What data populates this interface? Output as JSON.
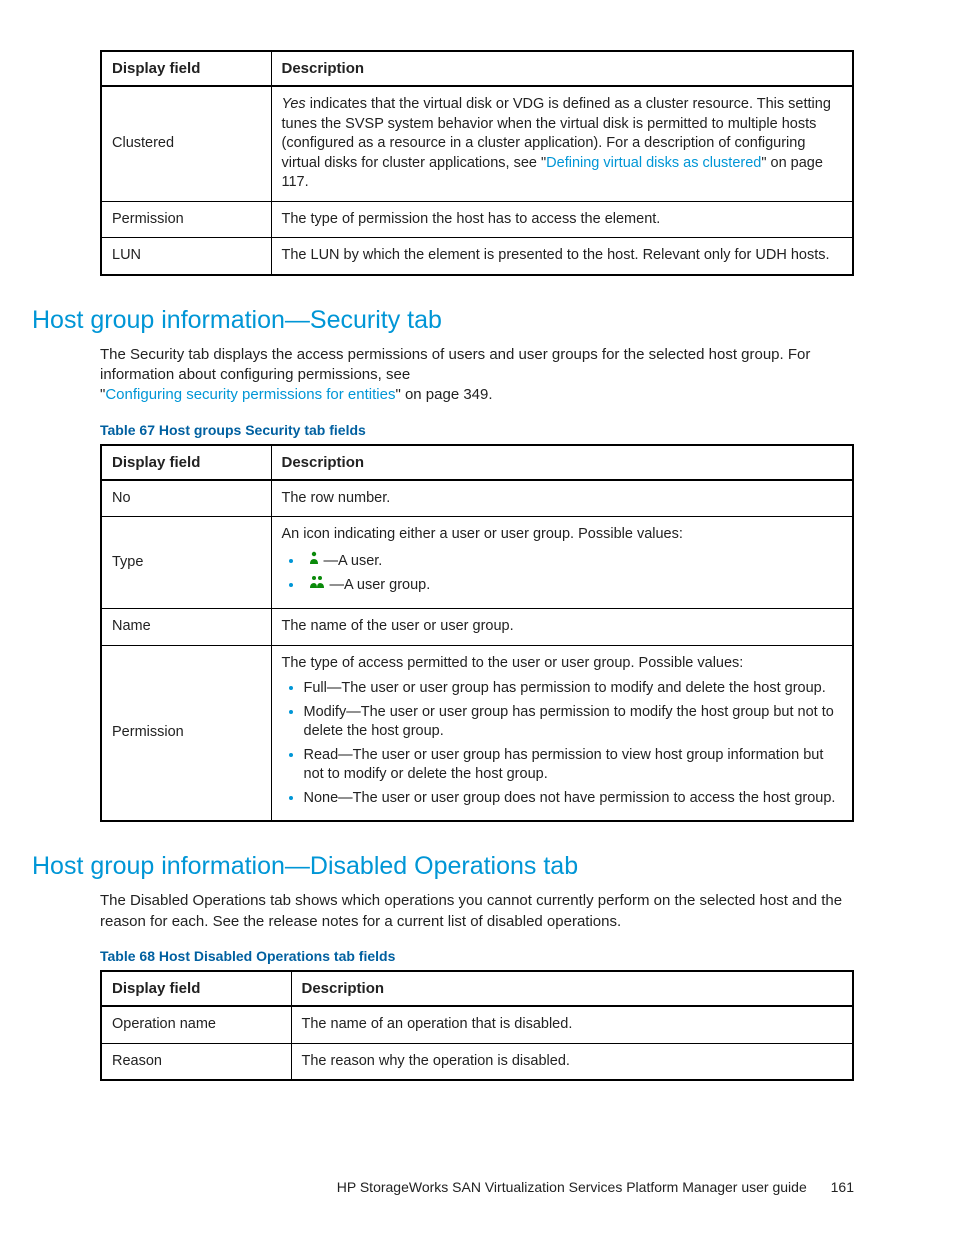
{
  "tableTop": {
    "headers": [
      "Display field",
      "Description"
    ],
    "rows": [
      {
        "field": "Clustered",
        "desc_pre_italic": "Yes",
        "desc_rest": " indicates that the virtual disk or VDG is defined as a cluster resource. This setting tunes the SVSP system behavior when the virtual disk is permitted to multiple hosts (configured as a resource in a cluster application). For a description of configuring virtual disks for cluster applications, see \"",
        "desc_link": "Defining virtual disks as clustered",
        "desc_after": "\" on page 117."
      },
      {
        "field": "Permission",
        "desc": "The type of permission the host has to access the element."
      },
      {
        "field": "LUN",
        "desc": "The LUN by which the element is presented to the host. Relevant only for UDH hosts."
      }
    ]
  },
  "sec1": {
    "heading": "Host group information—Security tab",
    "para_pre": "The Security tab displays the access permissions of users and user groups for the selected host group. For information about configuring permissions, see",
    "para_link": "Configuring security permissions for entities",
    "para_after": "\" on page 349.",
    "caption": "Table 67 Host groups Security tab fields",
    "headers": [
      "Display field",
      "Description"
    ],
    "no_field": "No",
    "no_desc": "The row number.",
    "type_field": "Type",
    "type_intro": "An icon indicating either a user or user group. Possible values:",
    "type_user": "—A user.",
    "type_group": "—A user group.",
    "name_field": "Name",
    "name_desc": "The name of the user or user group.",
    "perm_field": "Permission",
    "perm_intro": "The type of access permitted to the user or user group. Possible values:",
    "perm_items": [
      "Full—The user or user group has permission to modify and delete the host group.",
      "Modify—The user or user group has permission to modify the host group but not to delete the host group.",
      "Read—The user or user group has permission to view host group information but not to modify or delete the host group.",
      "None—The user or user group does not have permission to access the host group."
    ]
  },
  "sec2": {
    "heading": "Host group information—Disabled Operations tab",
    "para": "The Disabled Operations tab shows which operations you cannot currently perform on the selected host and the reason for each. See the release notes for a current list of disabled operations.",
    "caption": "Table 68 Host Disabled Operations tab fields",
    "headers": [
      "Display field",
      "Description"
    ],
    "rows": [
      {
        "field": "Operation name",
        "desc": "The name of an operation that is disabled."
      },
      {
        "field": "Reason",
        "desc": "The reason why the operation is disabled."
      }
    ]
  },
  "footer": {
    "title": "HP StorageWorks SAN Virtualization Services Platform Manager user guide",
    "page": "161"
  }
}
